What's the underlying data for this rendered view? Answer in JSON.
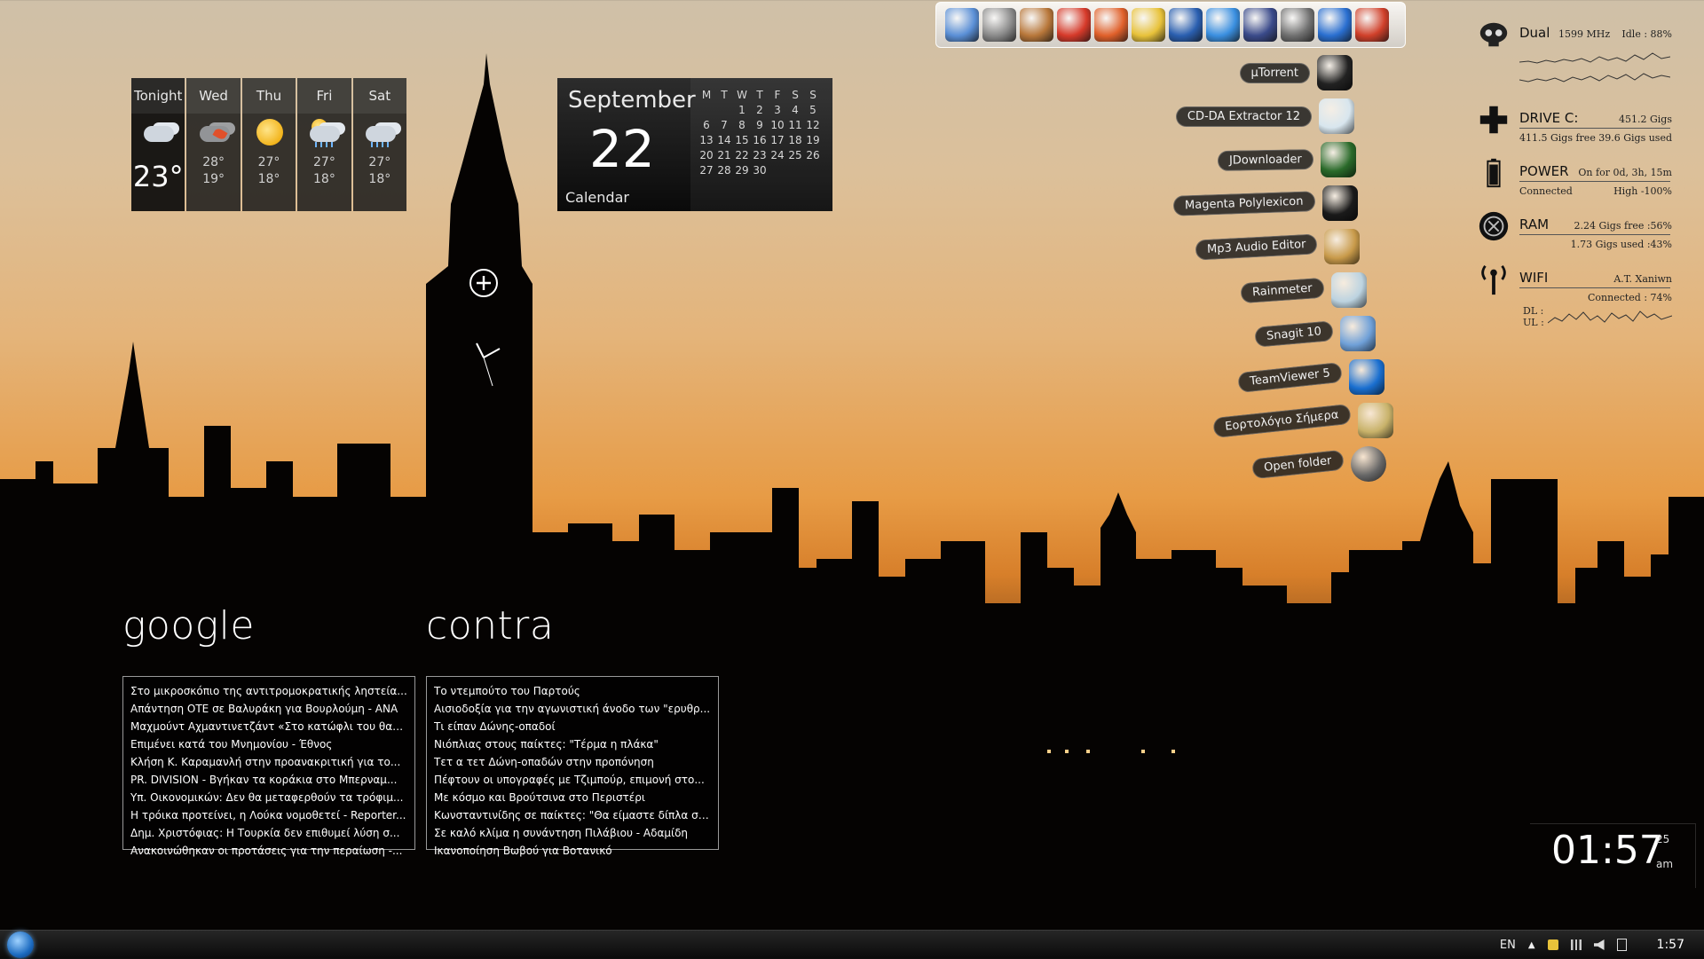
{
  "weather": {
    "days": [
      {
        "label": "Tonight",
        "icon": "partly-cloudy-night-icon",
        "temp": "23°"
      },
      {
        "label": "Wed",
        "icon": "windy-leaves-icon",
        "high": "28°",
        "low": "19°"
      },
      {
        "label": "Thu",
        "icon": "sunny-icon",
        "high": "27°",
        "low": "18°"
      },
      {
        "label": "Fri",
        "icon": "rain-showers-icon",
        "high": "27°",
        "low": "18°"
      },
      {
        "label": "Sat",
        "icon": "rain-showers-icon",
        "high": "27°",
        "low": "18°"
      }
    ]
  },
  "calendar": {
    "month": "September",
    "day": "22",
    "label": "Calendar",
    "weekdays": [
      "M",
      "T",
      "W",
      "T",
      "F",
      "S",
      "S"
    ],
    "weeks": [
      [
        "",
        "",
        "1",
        "2",
        "3",
        "4",
        "5"
      ],
      [
        "6",
        "7",
        "8",
        "9",
        "10",
        "11",
        "12"
      ],
      [
        "13",
        "14",
        "15",
        "16",
        "17",
        "18",
        "19"
      ],
      [
        "20",
        "21",
        "22",
        "23",
        "24",
        "25",
        "26"
      ],
      [
        "27",
        "28",
        "29",
        "30",
        "",
        "",
        ""
      ]
    ]
  },
  "dock": {
    "icons": [
      "laptop-icon",
      "gears-icon",
      "bucket-icon",
      "acrobat-icon",
      "firefox-icon",
      "cd-icon",
      "globe-icon",
      "media-player-icon",
      "clapper-icon",
      "tools-icon",
      "play-icon",
      "package-icon"
    ]
  },
  "launcher": {
    "items": [
      {
        "label": "µTorrent",
        "icon": "utorrent-icon"
      },
      {
        "label": "CD-DA Extractor 12",
        "icon": "cd-extractor-icon"
      },
      {
        "label": "JDownloader",
        "icon": "jdownloader-icon"
      },
      {
        "label": "Magenta Polylexicon",
        "icon": "book-icon"
      },
      {
        "label": "Mp3 Audio Editor",
        "icon": "palette-icon"
      },
      {
        "label": "Rainmeter",
        "icon": "raindrop-icon"
      },
      {
        "label": "Snagit 10",
        "icon": "snagit-icon"
      },
      {
        "label": "TeamViewer 5",
        "icon": "teamviewer-icon"
      },
      {
        "label": "Εορτολόγιο Σήμερα",
        "icon": "smiley-book-icon"
      },
      {
        "label": "Open folder",
        "icon": "folder-arrow-icon"
      }
    ]
  },
  "sysmon": {
    "cpu": {
      "title": "Dual",
      "freq": "1599 MHz",
      "idle": "Idle : 88%"
    },
    "drive": {
      "title": "DRIVE C:",
      "total": "451.2 Gigs",
      "free": "411.5 Gigs free",
      "used": "39.6 Gigs used"
    },
    "power": {
      "title": "POWER",
      "uptime": "On for 0d, 3h, 15m",
      "status": "Connected",
      "level": "High -100%"
    },
    "ram": {
      "title": "RAM",
      "free": "2.24 Gigs free :56%",
      "used": "1.73 Gigs used :43%"
    },
    "wifi": {
      "title": "WIFI",
      "ssid": "A.T. Xaniwn",
      "status": "Connected : 74%",
      "dl": "DL :",
      "ul": "UL :"
    }
  },
  "feeds": {
    "google": {
      "title": "google",
      "items": [
        "Στο μικροσκόπιο της αντιτρομοκρατικής ληστεία...",
        "Απάντηση ΟΤΕ σε Βαλυράκη για Βουρλούμη - ΑΝΑ",
        "Μαχμούντ Αχμαντινετζάντ «Στο κατώφλι του θαν...",
        "Επιμένει κατά του Μνημονίου - Έθνος",
        "Κλήση Κ. Καραμανλή στην προανακριτική για το...",
        "PR. DIVISION - Βγήκαν τα κοράκια στο Μπερναμ...",
        "Υπ. Οικονομικών: Δεν θα μεταφερθούν τα τρόφιμ...",
        "Η τρόικα προτείνει, η Λούκα νομοθετεί - Reporter...",
        "Δημ. Χριστόφιας: Η Τουρκία δεν επιθυμεί λύση σ...",
        "Ανακοινώθηκαν οι προτάσεις για την περαίωση -..."
      ]
    },
    "contra": {
      "title": "contra",
      "items": [
        "Το ντεμπούτο του Παρτούς",
        "Αισιοδοξία για την αγωνιστική άνοδο των \"ερυθρ...",
        "Τι είπαν Δώνης-οπαδοί",
        "Νιόπλιας στους παίκτες: \"Τέρμα η πλάκα\"",
        "Τετ α τετ Δώνη-οπαδών στην προπόνηση",
        "Πέφτουν οι υπογραφές με Τζιμπούρ, επιμονή στο...",
        "Με κόσμο και Βρούτσινα στο Περιστέρι",
        "Κωνσταντινίδης σε παίκτες: \"Θα είμαστε δίπλα σε...",
        "Σε καλό κλίμα η συνάντηση Πιλάβιου - Αδαμίδη",
        "Ικανοποίηση Βωβού για Βοτανικό"
      ]
    }
  },
  "digital_clock": {
    "time": "01:57",
    "seconds": "25",
    "ampm": "am"
  },
  "taskbar": {
    "language": "EN",
    "clock": "1:57"
  }
}
